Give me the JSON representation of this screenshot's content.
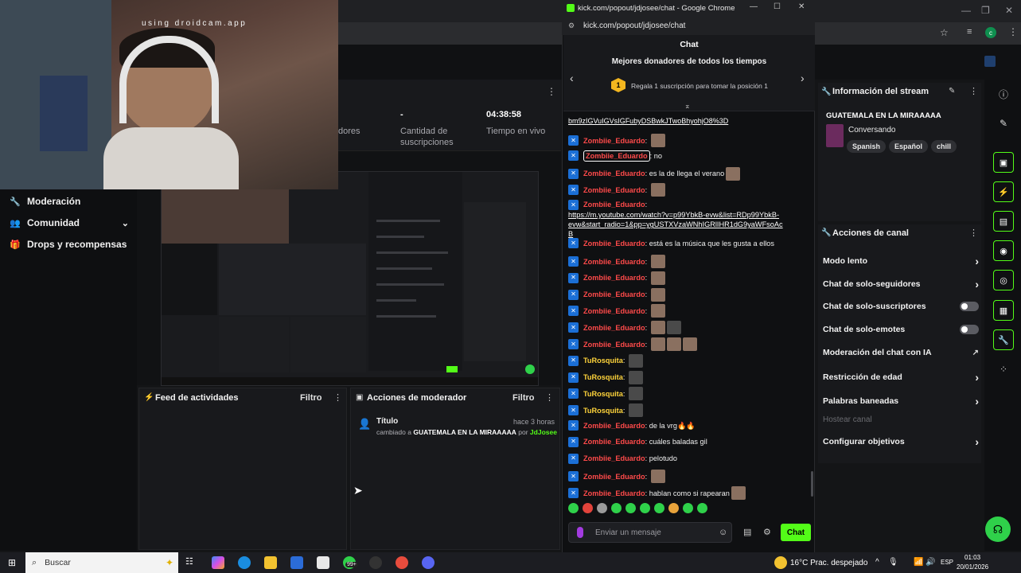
{
  "webcam": {
    "watermark": "using droidcam.app"
  },
  "background_app": {
    "stats": [
      {
        "value": "",
        "label": "dores"
      },
      {
        "value": "-",
        "label": "Cantidad de suscripciones"
      },
      {
        "value": "04:38:58",
        "label": "Tiempo en vivo"
      }
    ],
    "nav": [
      {
        "label": "Moderación",
        "icon": "wrench-icon"
      },
      {
        "label": "Comunidad",
        "icon": "users-icon"
      },
      {
        "label": "Drops y recompensas",
        "icon": "gift-icon"
      }
    ],
    "activity_feed": {
      "title": "Feed de actividades",
      "filter": "Filtro"
    },
    "mod_actions": {
      "title": "Acciones de moderador",
      "filter": "Filtro",
      "entry": {
        "title": "Título",
        "time": "hace 3 horas",
        "prefix": "cambiado a",
        "value": "GUATEMALA EN LA MIRAAAAA",
        "by": "por",
        "user": "JdJosee"
      }
    },
    "stream_info": {
      "header": "Información del stream",
      "title": "GUATEMALA EN LA MIRAAAAA",
      "category": "Conversando",
      "tags": [
        "Spanish",
        "Español",
        "chill"
      ]
    },
    "channel_actions": {
      "header": "Acciones de canal",
      "items": [
        {
          "label": "Modo lento",
          "control": "chevron"
        },
        {
          "label": "Chat de solo-seguidores",
          "control": "chevron"
        },
        {
          "label": "Chat de solo-suscriptores",
          "control": "toggle"
        },
        {
          "label": "Chat de solo-emotes",
          "control": "toggle"
        },
        {
          "label": "Moderación del chat con IA",
          "control": "external"
        },
        {
          "label": "Restricción de edad",
          "control": "chevron"
        },
        {
          "label": "Palabras baneadas",
          "control": "chevron"
        },
        {
          "label": "Hostear canal",
          "control": "none"
        },
        {
          "label": "Configurar objetivos",
          "control": "chevron"
        }
      ]
    }
  },
  "chat_window": {
    "window_title": "kick.com/popout/jdjosee/chat - Google Chrome",
    "url": "kick.com/popout/jdjosee/chat",
    "header": "Chat",
    "donors_title": "Mejores donadores de todos los tiempos",
    "donors_rank": "1",
    "donors_cta": "Regala 1 suscripción para tomar la posición 1",
    "top_link": "bm9zIGVuIGVsIGFubyDSBwkJTwoBhyohjO8%3D",
    "messages": [
      {
        "user": "Zombiie_Eduardo",
        "color": "red",
        "text": "",
        "emotes": 1
      },
      {
        "user": "Zombiie_Eduardo",
        "color": "red",
        "text": "no",
        "emotes": 0,
        "highlight": true
      },
      {
        "user": "Zombiie_Eduardo",
        "color": "red",
        "text": "es la de llega el verano",
        "emotes": 1
      },
      {
        "user": "Zombiie_Eduardo",
        "color": "red",
        "text": "",
        "emotes": 1
      },
      {
        "user": "Zombiie_Eduardo",
        "color": "red",
        "link": "https://m.youtube.com/watch?v=p99YbkB-evw&list=RDp99YbkB-evw&start_radio=1&pp=ygUSTXVzaWNhIGRlIHR1dG9yaWFsoAcB",
        "emotes": 0
      },
      {
        "user": "Zombiie_Eduardo",
        "color": "red",
        "text": "está es la música que les gusta a ellos",
        "emotes": 0
      },
      {
        "user": "Zombiie_Eduardo",
        "color": "red",
        "text": "",
        "emotes": 1
      },
      {
        "user": "Zombiie_Eduardo",
        "color": "red",
        "text": "",
        "emotes": 1
      },
      {
        "user": "Zombiie_Eduardo",
        "color": "red",
        "text": "",
        "emotes": 1
      },
      {
        "user": "Zombiie_Eduardo",
        "color": "red",
        "text": "",
        "emotes": 1
      },
      {
        "user": "Zombiie_Eduardo",
        "color": "red",
        "text": "",
        "emotes": 2
      },
      {
        "user": "Zombiie_Eduardo",
        "color": "red",
        "text": "",
        "emotes": 3
      },
      {
        "user": "TuRosquita",
        "color": "yellow",
        "text": "",
        "emotes": 1
      },
      {
        "user": "TuRosquita",
        "color": "yellow",
        "text": "",
        "emotes": 1
      },
      {
        "user": "TuRosquita",
        "color": "yellow",
        "text": "",
        "emotes": 1
      },
      {
        "user": "TuRosquita",
        "color": "yellow",
        "text": "",
        "emotes": 1
      },
      {
        "user": "Zombiie_Eduardo",
        "color": "red",
        "text": "de la vrg🔥🔥",
        "emotes": 0
      },
      {
        "user": "Zombiie_Eduardo",
        "color": "red",
        "text": "cuáles baladas gil",
        "emotes": 0
      },
      {
        "user": "Zombiie_Eduardo",
        "color": "red",
        "text": "pelotudo",
        "emotes": 0
      },
      {
        "user": "Zombiie_Eduardo",
        "color": "red",
        "text": "",
        "emotes": 1
      },
      {
        "user": "Zombiie_Eduardo",
        "color": "red",
        "text": "hablan como si rapearan",
        "emotes": 1
      }
    ],
    "input_placeholder": "Enviar un mensaje",
    "send_label": "Chat"
  },
  "taskbar": {
    "search_placeholder": "Buscar",
    "notif_badge": "99+",
    "weather": "16°C  Prac. despejado",
    "lang": "ESP",
    "time": "01:03",
    "date": "20/01/2026"
  }
}
